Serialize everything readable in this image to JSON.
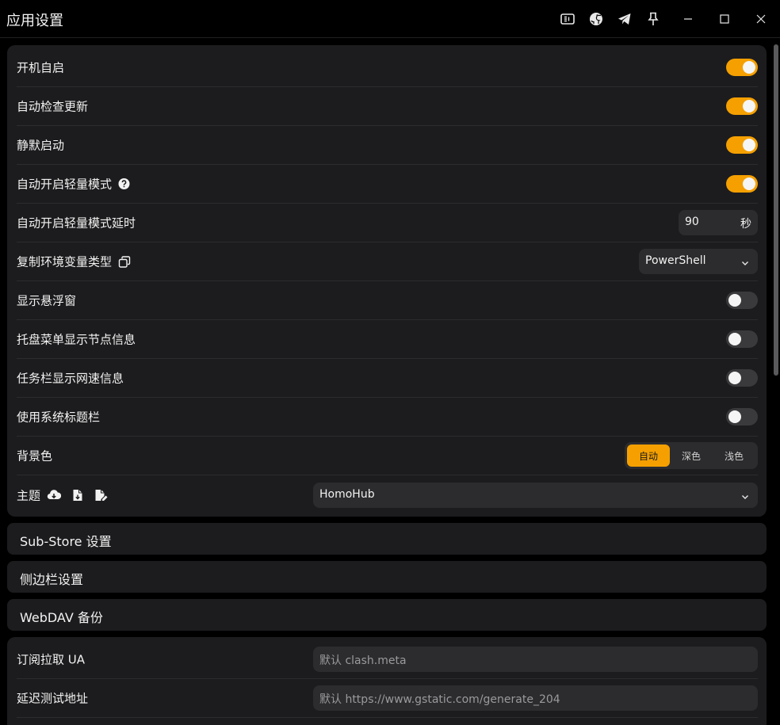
{
  "window": {
    "title": "应用设置",
    "toolbar_icons": [
      "docs-icon",
      "github-icon",
      "telegram-icon",
      "pin-icon"
    ],
    "controls": [
      "minimize-icon",
      "maximize-icon",
      "close-icon"
    ]
  },
  "accent_color": "#f5a000",
  "general": {
    "auto_launch": {
      "label": "开机自启",
      "on": true
    },
    "auto_check_update": {
      "label": "自动检查更新",
      "on": true
    },
    "silent_start": {
      "label": "静默启动",
      "on": true
    },
    "auto_lite_mode": {
      "label": "自动开启轻量模式",
      "on": true
    },
    "auto_lite_delay": {
      "label": "自动开启轻量模式延时",
      "value": "90",
      "unit": "秒"
    },
    "env_var_type": {
      "label": "复制环境变量类型",
      "value": "PowerShell"
    },
    "show_float_window": {
      "label": "显示悬浮窗",
      "on": false
    },
    "tray_show_node": {
      "label": "托盘菜单显示节点信息",
      "on": false
    },
    "taskbar_show_speed": {
      "label": "任务栏显示网速信息",
      "on": false
    },
    "system_titlebar": {
      "label": "使用系统标题栏",
      "on": false
    },
    "background": {
      "label": "背景色",
      "options": [
        "自动",
        "深色",
        "浅色"
      ],
      "selected": "自动"
    },
    "theme": {
      "label": "主题",
      "value": "HomoHub"
    }
  },
  "sections": {
    "substore": "Sub-Store 设置",
    "sidebar": "侧边栏设置",
    "webdav": "WebDAV 备份"
  },
  "network": {
    "ua": {
      "label": "订阅拉取 UA",
      "placeholder": "默认 clash.meta"
    },
    "delay_url": {
      "label": "延迟测试地址",
      "placeholder": "默认 https://www.gstatic.com/generate_204"
    }
  }
}
